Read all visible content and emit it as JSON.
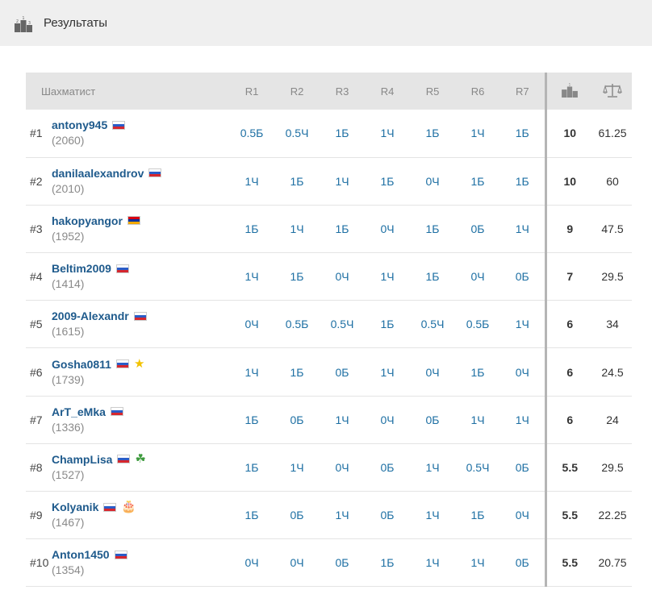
{
  "header": {
    "title": "Результаты",
    "icon": "podium-icon"
  },
  "table": {
    "columns": {
      "player": "Шахматист",
      "rounds": [
        "R1",
        "R2",
        "R3",
        "R4",
        "R5",
        "R6",
        "R7"
      ],
      "points_icon": "podium-icon",
      "tiebreak_icon": "scales-icon"
    },
    "rows": [
      {
        "rank": "#1",
        "name": "antony945",
        "rating": "(2060)",
        "flag": "ru",
        "badge": "",
        "results": [
          "0.5Б",
          "0.5Ч",
          "1Б",
          "1Ч",
          "1Б",
          "1Ч",
          "1Б"
        ],
        "points": "10",
        "tiebreak": "61.25"
      },
      {
        "rank": "#2",
        "name": "danilaalexandrov",
        "rating": "(2010)",
        "flag": "ru",
        "badge": "",
        "results": [
          "1Ч",
          "1Б",
          "1Ч",
          "1Б",
          "0Ч",
          "1Б",
          "1Б"
        ],
        "points": "10",
        "tiebreak": "60"
      },
      {
        "rank": "#3",
        "name": "hakopyangor",
        "rating": "(1952)",
        "flag": "am",
        "badge": "",
        "results": [
          "1Б",
          "1Ч",
          "1Б",
          "0Ч",
          "1Б",
          "0Б",
          "1Ч"
        ],
        "points": "9",
        "tiebreak": "47.5"
      },
      {
        "rank": "#4",
        "name": "Beltim2009",
        "rating": "(1414)",
        "flag": "ru",
        "badge": "",
        "results": [
          "1Ч",
          "1Б",
          "0Ч",
          "1Ч",
          "1Б",
          "0Ч",
          "0Б"
        ],
        "points": "7",
        "tiebreak": "29.5"
      },
      {
        "rank": "#5",
        "name": "2009-Alexandr",
        "rating": "(1615)",
        "flag": "ru",
        "badge": "",
        "results": [
          "0Ч",
          "0.5Б",
          "0.5Ч",
          "1Б",
          "0.5Ч",
          "0.5Б",
          "1Ч"
        ],
        "points": "6",
        "tiebreak": "34"
      },
      {
        "rank": "#6",
        "name": "Gosha0811",
        "rating": "(1739)",
        "flag": "ru",
        "badge": "star",
        "results": [
          "1Ч",
          "1Б",
          "0Б",
          "1Ч",
          "0Ч",
          "1Б",
          "0Ч"
        ],
        "points": "6",
        "tiebreak": "24.5"
      },
      {
        "rank": "#7",
        "name": "ArT_eMka",
        "rating": "(1336)",
        "flag": "ru",
        "badge": "",
        "results": [
          "1Б",
          "0Б",
          "1Ч",
          "0Ч",
          "0Б",
          "1Ч",
          "1Ч"
        ],
        "points": "6",
        "tiebreak": "24"
      },
      {
        "rank": "#8",
        "name": "ChampLisa",
        "rating": "(1527)",
        "flag": "ru",
        "badge": "clover",
        "results": [
          "1Б",
          "1Ч",
          "0Ч",
          "0Б",
          "1Ч",
          "0.5Ч",
          "0Б"
        ],
        "points": "5.5",
        "tiebreak": "29.5"
      },
      {
        "rank": "#9",
        "name": "Kolyanik",
        "rating": "(1467)",
        "flag": "ru",
        "badge": "cake",
        "results": [
          "1Б",
          "0Б",
          "1Ч",
          "0Б",
          "1Ч",
          "1Б",
          "0Ч"
        ],
        "points": "5.5",
        "tiebreak": "22.25"
      },
      {
        "rank": "#10",
        "name": "Anton1450",
        "rating": "(1354)",
        "flag": "ru",
        "badge": "",
        "results": [
          "0Ч",
          "0Ч",
          "0Б",
          "1Б",
          "1Ч",
          "1Ч",
          "0Б"
        ],
        "points": "5.5",
        "tiebreak": "20.75"
      }
    ]
  }
}
